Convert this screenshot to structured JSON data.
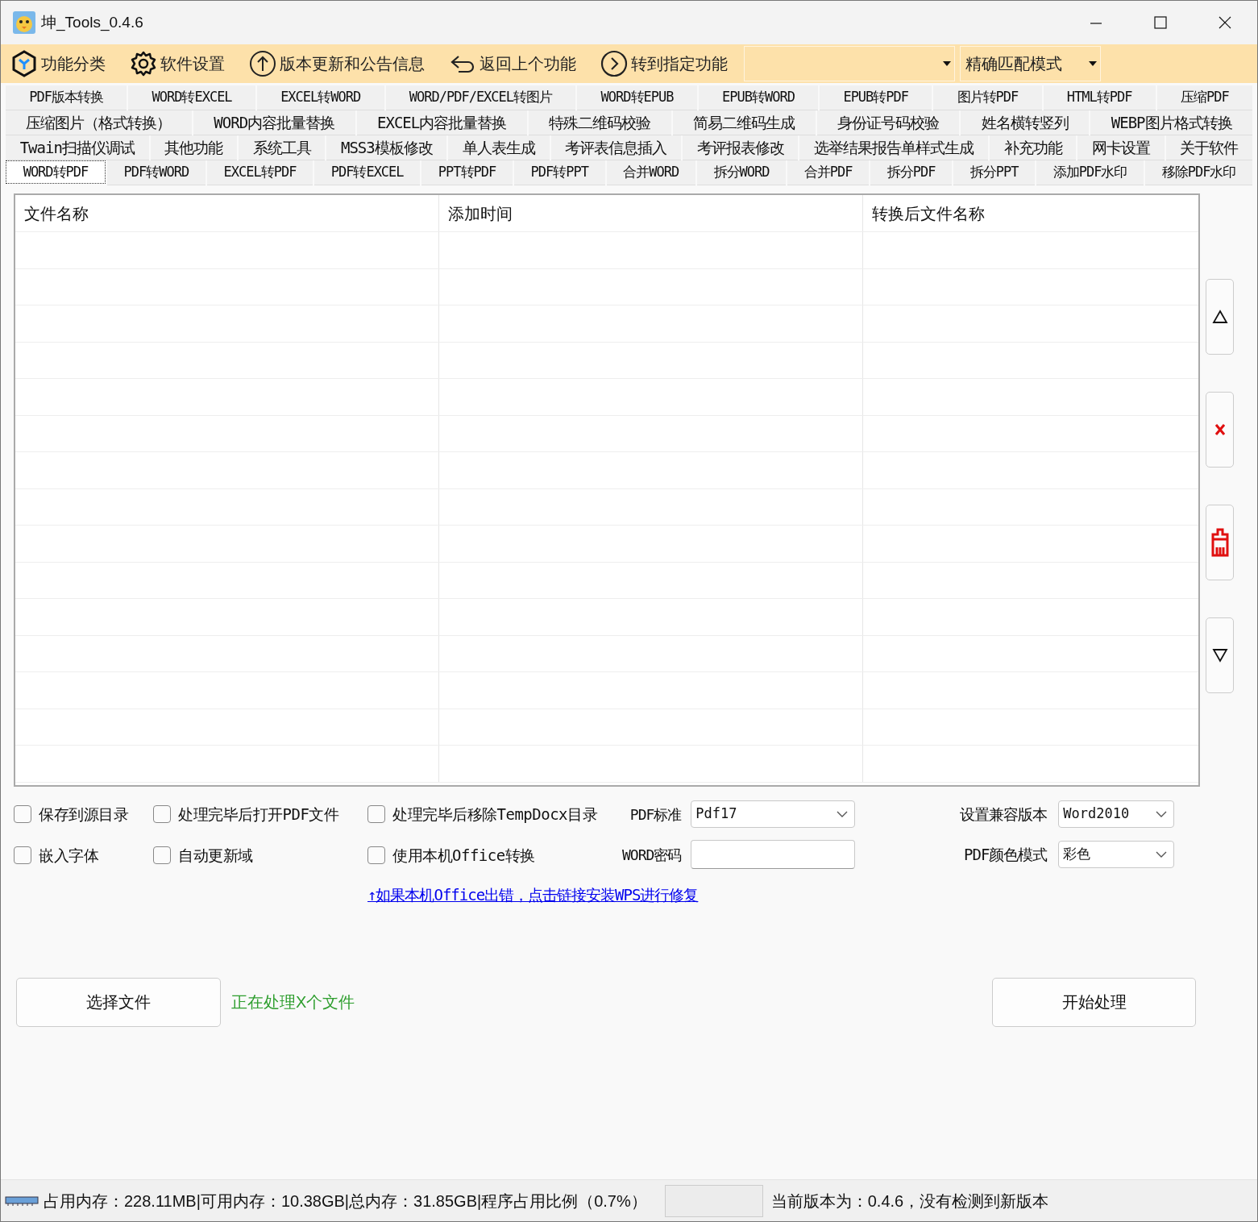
{
  "window": {
    "title": "坤_Tools_0.4.6"
  },
  "toolbar": {
    "items": [
      {
        "kind": "category",
        "label": "功能分类"
      },
      {
        "kind": "settings",
        "label": "软件设置"
      },
      {
        "kind": "update",
        "label": "版本更新和公告信息"
      },
      {
        "kind": "back",
        "label": "返回上个功能"
      },
      {
        "kind": "goto",
        "label": "转到指定功能"
      }
    ],
    "mode_select": {
      "value": "精确匹配模式"
    }
  },
  "tab_rows": [
    [
      {
        "label": "PDF版本转换",
        "selected": false
      },
      {
        "label": "WORD转EXCEL",
        "selected": false
      },
      {
        "label": "EXCEL转WORD",
        "selected": false
      },
      {
        "label": "WORD/PDF/EXCEL转图片",
        "selected": false
      },
      {
        "label": "WORD转EPUB",
        "selected": false
      },
      {
        "label": "EPUB转WORD",
        "selected": false
      },
      {
        "label": "EPUB转PDF",
        "selected": false
      },
      {
        "label": "图片转PDF",
        "selected": false
      },
      {
        "label": "HTML转PDF",
        "selected": false
      },
      {
        "label": "压缩PDF",
        "selected": false
      }
    ],
    [
      {
        "label": "压缩图片（格式转换）",
        "selected": false
      },
      {
        "label": "WORD内容批量替换",
        "selected": false
      },
      {
        "label": "EXCEL内容批量替换",
        "selected": false
      },
      {
        "label": "特殊二维码校验",
        "selected": false
      },
      {
        "label": "简易二维码生成",
        "selected": false
      },
      {
        "label": "身份证号码校验",
        "selected": false
      },
      {
        "label": "姓名横转竖列",
        "selected": false
      },
      {
        "label": "WEBP图片格式转换",
        "selected": false
      }
    ],
    [
      {
        "label": "Twain扫描仪调试",
        "selected": false
      },
      {
        "label": "其他功能",
        "selected": false
      },
      {
        "label": "系统工具",
        "selected": false
      },
      {
        "label": "MSS3模板修改",
        "selected": false
      },
      {
        "label": "单人表生成",
        "selected": false
      },
      {
        "label": "考评表信息插入",
        "selected": false
      },
      {
        "label": "考评报表修改",
        "selected": false
      },
      {
        "label": "选举结果报告单样式生成",
        "selected": false
      },
      {
        "label": "补充功能",
        "selected": false
      },
      {
        "label": "网卡设置",
        "selected": false
      },
      {
        "label": "关于软件",
        "selected": false
      }
    ],
    [
      {
        "label": "WORD转PDF",
        "selected": true
      },
      {
        "label": "PDF转WORD",
        "selected": false
      },
      {
        "label": "EXCEL转PDF",
        "selected": false
      },
      {
        "label": "PDF转EXCEL",
        "selected": false
      },
      {
        "label": "PPT转PDF",
        "selected": false
      },
      {
        "label": "PDF转PPT",
        "selected": false
      },
      {
        "label": "合并WORD",
        "selected": false
      },
      {
        "label": "拆分WORD",
        "selected": false
      },
      {
        "label": "合并PDF",
        "selected": false
      },
      {
        "label": "拆分PDF",
        "selected": false
      },
      {
        "label": "拆分PPT",
        "selected": false
      },
      {
        "label": "添加PDF水印",
        "selected": false
      },
      {
        "label": "移除PDF水印",
        "selected": false
      }
    ]
  ],
  "table": {
    "columns": [
      "文件名称",
      "添加时间",
      "转换后文件名称"
    ]
  },
  "side_buttons": [
    {
      "kind": "up"
    },
    {
      "kind": "remove"
    },
    {
      "kind": "clear"
    },
    {
      "kind": "down"
    }
  ],
  "options": {
    "checkboxes": [
      [
        {
          "label": "保存到源目录",
          "checked": false
        },
        {
          "label": "处理完毕后打开PDF文件",
          "checked": false
        },
        {
          "label": "处理完毕后移除TempDocx目录",
          "checked": false
        }
      ],
      [
        {
          "label": "嵌入字体",
          "checked": false
        },
        {
          "label": "自动更新域",
          "checked": false
        },
        {
          "label": "使用本机Office转换",
          "checked": false
        }
      ]
    ],
    "pdf_standard": {
      "label": "PDF标准",
      "value": "Pdf17"
    },
    "word_password": {
      "label": "WORD密码"
    },
    "compat_version": {
      "label": "设置兼容版本",
      "value": "Word2010"
    },
    "color_mode": {
      "label": "PDF颜色模式",
      "value": "彩色"
    },
    "repair_link": "↑如果本机Office出错，点击链接安装WPS进行修复"
  },
  "actions": {
    "select_files": "选择文件",
    "status": "正在处理X个文件",
    "start": "开始处理"
  },
  "status_bar": {
    "memory": "占用内存：228.11MB|可用内存：10.38GB|总内存：31.85GB|程序占用比例（0.7%）",
    "version": "当前版本为：0.4.6，没有检测到新版本"
  }
}
